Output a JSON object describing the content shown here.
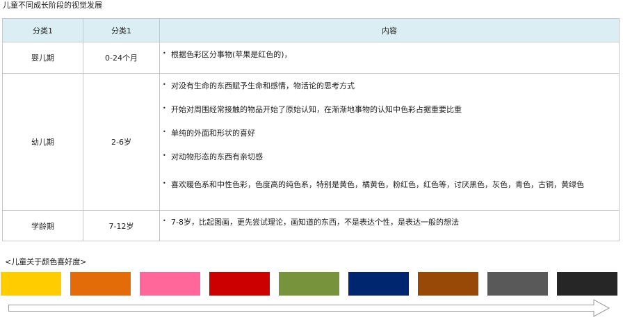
{
  "page_title": "儿童不同成长阶段的视觉发展",
  "table": {
    "headers": [
      "分类1",
      "分类1",
      "内容"
    ],
    "rows": [
      {
        "category": "婴儿期",
        "age": "0-24个月",
        "items": [
          "根据色彩区分事物(苹果是红色的)，"
        ]
      },
      {
        "category": "幼儿期",
        "age": "2-6岁",
        "items": [
          "对没有生命的东西赋予生命和感情，物活论的思考方式",
          "开始对周围经常接触的物品开始了原始认知，在渐渐地事物的认知中色彩占据重要比重",
          "单纯的外面和形状的喜好",
          "对动物形态的东西有亲切感",
          "喜欢暖色系和中性色彩，色度高的纯色系，特别是黄色，橘黄色，粉红色，红色等，讨厌黑色，灰色，青色，古铜，黄绿色"
        ]
      },
      {
        "category": "学龄期",
        "age": "7-12岁",
        "items": [
          "7-8岁，比起图画，更先尝试理论，画知道的东西，不是表达个性，是表达一般的想法"
        ]
      }
    ],
    "bullet": "•"
  },
  "color_preference": {
    "title": "<儿童关于颜色喜好度>",
    "swatches": [
      {
        "name": "yellow",
        "color": "#ffcc00"
      },
      {
        "name": "orange",
        "color": "#e36c09"
      },
      {
        "name": "pink",
        "color": "#ff6699"
      },
      {
        "name": "red",
        "color": "#cc0000"
      },
      {
        "name": "olive-green",
        "color": "#77933c"
      },
      {
        "name": "navy-blue",
        "color": "#002670"
      },
      {
        "name": "brown",
        "color": "#984807"
      },
      {
        "name": "gray",
        "color": "#595959"
      },
      {
        "name": "black",
        "color": "#262626"
      }
    ]
  },
  "colors": {
    "header_bg": "#dbeef4",
    "border": "#c7c7c7",
    "arrow_stroke": "#999999"
  }
}
